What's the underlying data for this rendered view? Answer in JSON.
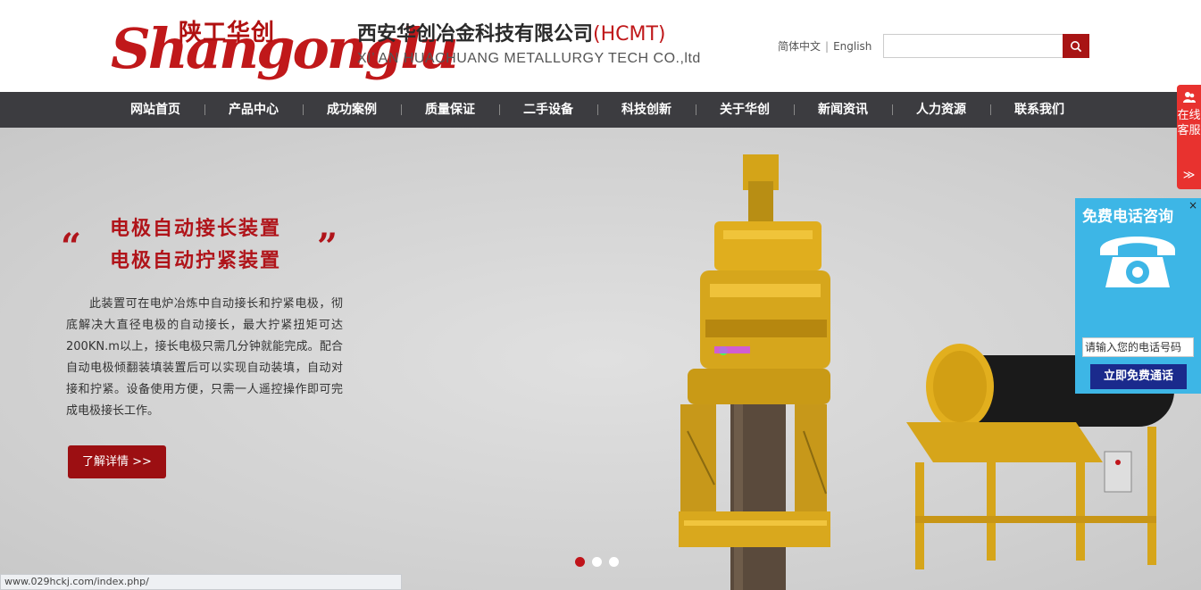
{
  "header": {
    "logo_cn": "陕工华创",
    "logo_en": "Shangonglu",
    "company_cn": "西安华创冶金科技有限公司",
    "company_abbr": "(HCMT)",
    "company_en": "XI’ AN HUACHUANG METALLURGY TECH CO.,ltd",
    "lang_cn": "简体中文",
    "lang_sep": "|",
    "lang_en": "English",
    "search_placeholder": ""
  },
  "nav": {
    "items": [
      {
        "label": "网站首页"
      },
      {
        "label": "产品中心"
      },
      {
        "label": "成功案例"
      },
      {
        "label": "质量保证"
      },
      {
        "label": "二手设备"
      },
      {
        "label": "科技创新"
      },
      {
        "label": "关于华创"
      },
      {
        "label": "新闻资讯"
      },
      {
        "label": "人力资源"
      },
      {
        "label": "联系我们"
      }
    ]
  },
  "banner": {
    "quote_left": "“",
    "quote_right": "”",
    "headline_1": "电极自动接长装置",
    "headline_2": "电极自动拧紧装置",
    "description": "此装置可在电炉冶炼中自动接长和拧紧电极，彻底解决大直径电极的自动接长，最大拧紧扭矩可达200KN.m以上，接长电极只需几分钟就能完成。配合自动电极倾翻装填装置后可以实现自动装填，自动对接和拧紧。设备使用方便，只需一人遥控操作即可完成电极接长工作。",
    "more_label": "了解详情 >>",
    "slide_count": 3,
    "active_slide": 1
  },
  "statusbar": {
    "url": "www.029hckj.com/index.php/"
  },
  "widgets": {
    "online_service": "在线客服",
    "online_arrow": "≫",
    "call_title": "免费电话咨询",
    "call_close": "×",
    "call_input_placeholder": "请输入您的电话号码",
    "call_button": "立即免费通话"
  },
  "colors": {
    "brand_red": "#b0141a",
    "nav_bg": "#3c3c40",
    "call_blue": "#3db6e6",
    "call_btn": "#1a2a8c"
  }
}
